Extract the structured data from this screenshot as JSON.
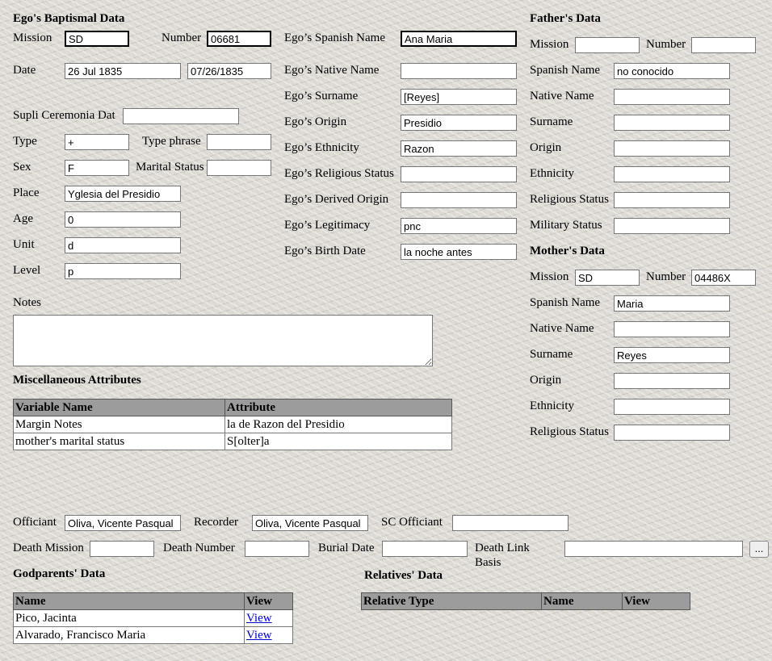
{
  "ego": {
    "heading": "Ego's Baptismal Data",
    "mission_label": "Mission",
    "mission_value": "SD",
    "number_label": "Number",
    "number_value": "06681",
    "date_label": "Date",
    "date_value": "26 Jul 1835",
    "date_numeric_value": "07/26/1835",
    "supli_label": "Supli Ceremonia Dat",
    "supli_value": "",
    "type_label": "Type",
    "type_value": "+",
    "type_phrase_label": "Type phrase",
    "type_phrase_value": "",
    "sex_label": "Sex",
    "sex_value": "F",
    "marital_label": "Marital Status",
    "marital_value": "",
    "place_label": "Place",
    "place_value": "Yglesia del Presidio",
    "age_label": "Age",
    "age_value": "0",
    "unit_label": "Unit",
    "unit_value": "d",
    "level_label": "Level",
    "level_value": "p",
    "notes_label": "Notes",
    "notes_value": ""
  },
  "ego_names": {
    "spanish_name_label": "Ego’s Spanish Name",
    "spanish_name_value": "Ana Maria",
    "native_name_label": "Ego’s Native Name",
    "native_name_value": "",
    "surname_label": "Ego’s Surname",
    "surname_value": "[Reyes]",
    "origin_label": "Ego’s Origin",
    "origin_value": "Presidio",
    "ethnicity_label": "Ego’s Ethnicity",
    "ethnicity_value": "Razon",
    "religious_label": "Ego’s Religious Status",
    "religious_value": "",
    "derived_label": "Ego’s Derived Origin",
    "derived_value": "",
    "legitimacy_label": "Ego’s Legitimacy",
    "legitimacy_value": "pnc",
    "birth_label": "Ego’s Birth Date",
    "birth_value": "la noche antes"
  },
  "father": {
    "heading": "Father's Data",
    "mission_label": "Mission",
    "mission_value": "",
    "number_label": "Number",
    "number_value": "",
    "spanish_label": "Spanish Name",
    "spanish_value": "no conocido",
    "native_label": "Native Name",
    "native_value": "",
    "surname_label": "Surname",
    "surname_value": "",
    "origin_label": "Origin",
    "origin_value": "",
    "ethnicity_label": "Ethnicity",
    "ethnicity_value": "",
    "religious_label": "Religious Status",
    "religious_value": "",
    "military_label": "Military Status",
    "military_value": ""
  },
  "mother": {
    "heading": "Mother's Data",
    "mission_label": "Mission",
    "mission_value": "SD",
    "number_label": "Number",
    "number_value": "04486X",
    "spanish_label": "Spanish Name",
    "spanish_value": "Maria",
    "native_label": "Native Name",
    "native_value": "",
    "surname_label": "Surname",
    "surname_value": "Reyes",
    "origin_label": "Origin",
    "origin_value": "",
    "ethnicity_label": "Ethnicity",
    "ethnicity_value": "",
    "religious_label": "Religious Status",
    "religious_value": ""
  },
  "misc": {
    "heading": "Miscellaneous Attributes",
    "col_variable": "Variable Name",
    "col_attribute": "Attribute",
    "rows": [
      {
        "variable": "Margin Notes",
        "attribute": "la de Razon del Presidio"
      },
      {
        "variable": "mother's marital status",
        "attribute": "S[olter]a"
      }
    ]
  },
  "officials": {
    "officiant_label": "Officiant",
    "officiant_value": "Oliva, Vicente Pasqual",
    "recorder_label": "Recorder",
    "recorder_value": "Oliva, Vicente Pasqual",
    "sc_officiant_label": "SC Officiant",
    "sc_officiant_value": ""
  },
  "death": {
    "mission_label": "Death Mission",
    "mission_value": "",
    "number_label": "Death Number",
    "number_value": "",
    "burial_label": "Burial Date",
    "burial_value": "",
    "link_label_1": "Death Link",
    "link_label_2": "Basis",
    "link_value": "",
    "browse_label": "..."
  },
  "godparents": {
    "heading": "Godparents' Data",
    "col_name": "Name",
    "col_view": "View",
    "rows": [
      {
        "name": "Pico, Jacinta",
        "view": "View"
      },
      {
        "name": "Alvarado, Francisco Maria",
        "view": "View"
      }
    ]
  },
  "relatives": {
    "heading": "Relatives' Data",
    "col_type": "Relative Type",
    "col_name": "Name",
    "col_view": "View"
  }
}
